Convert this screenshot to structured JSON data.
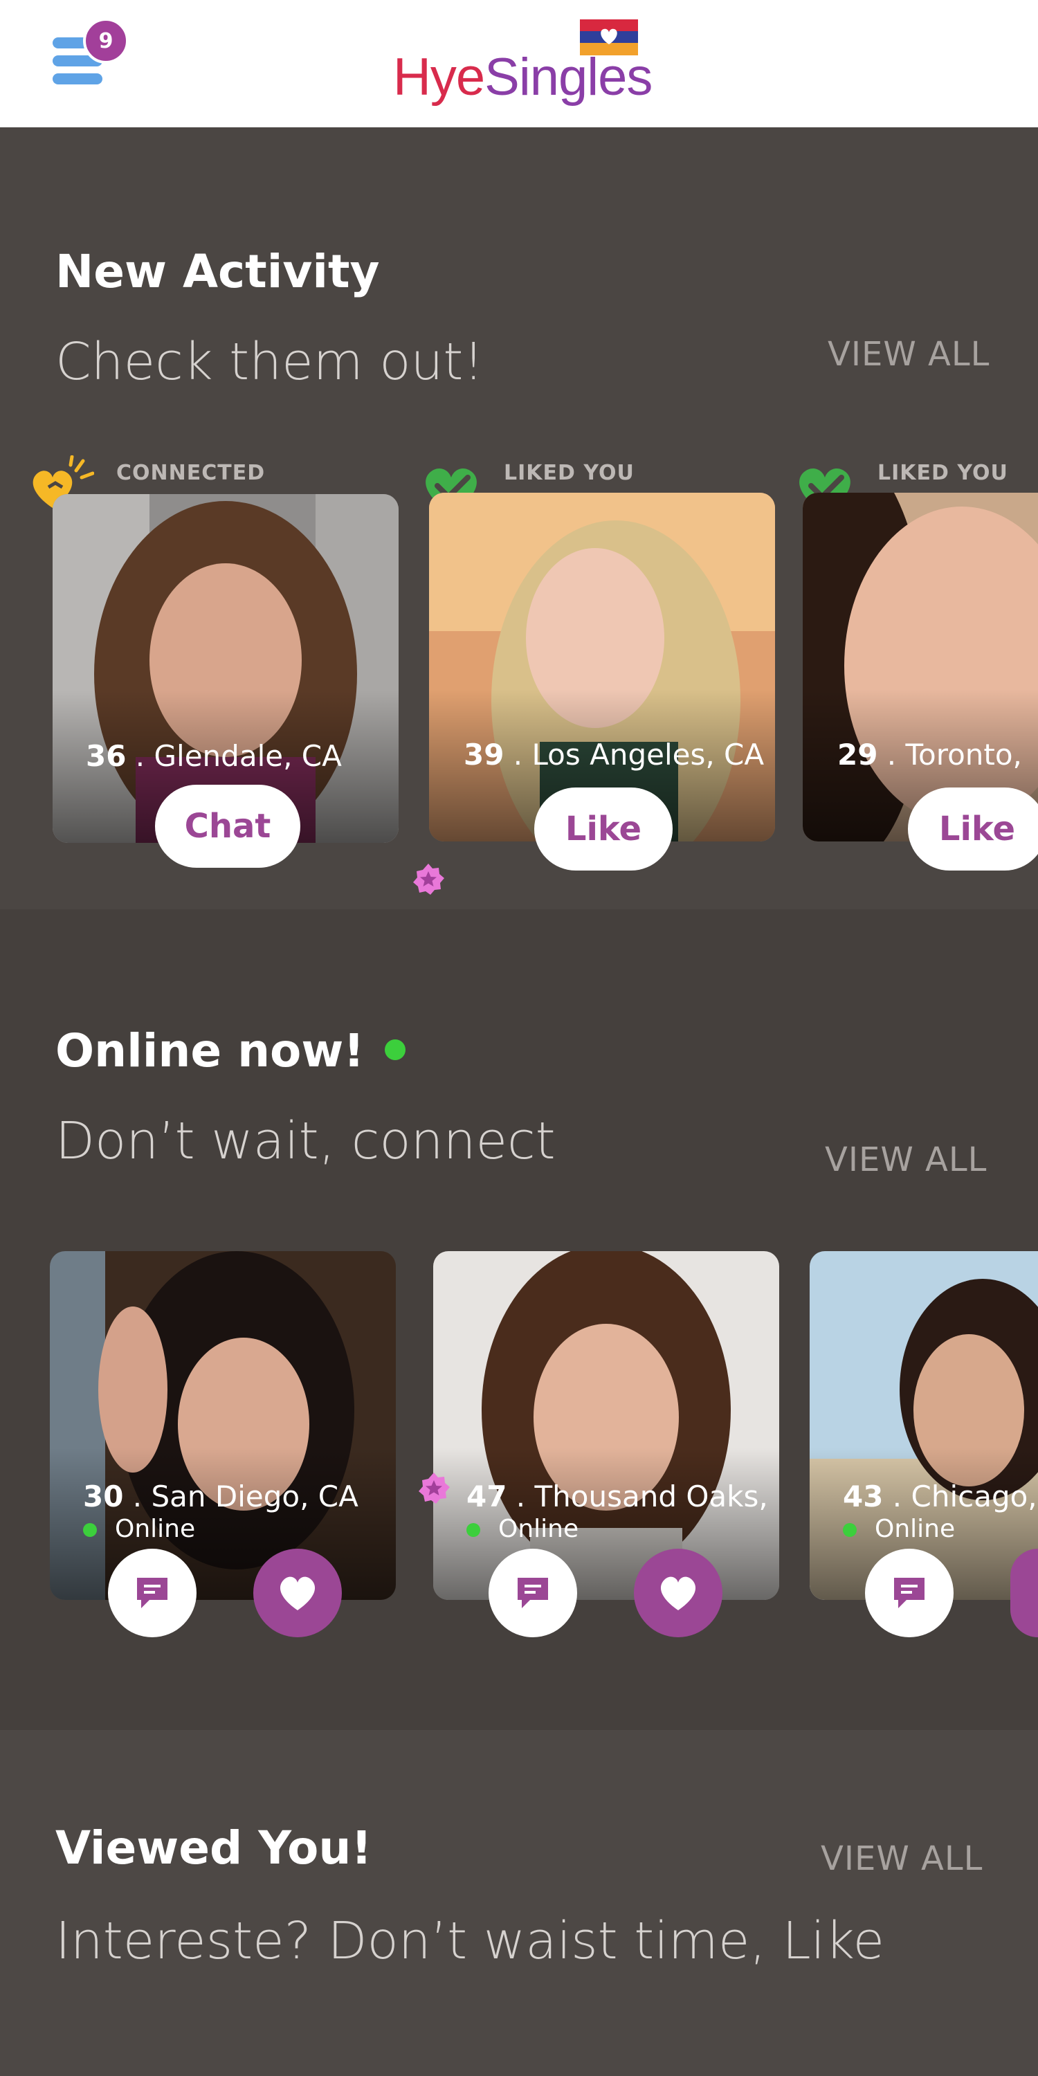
{
  "header": {
    "notification_count": "9",
    "logo": {
      "part1": "Hye",
      "part2": "Singles"
    },
    "colors": {
      "menu": "#5fa3e6",
      "badge": "#a23f9a",
      "logo_red": "#d82b4c",
      "logo_purple": "#8a3ea7"
    }
  },
  "new_activity": {
    "title": "New Activity",
    "subtitle": "Check them out!",
    "view_all": "VIEW ALL",
    "cards": [
      {
        "status": "CONNECTED",
        "status_icon": "connected-heart-icon",
        "age": "36",
        "location": " . Glendale, CA",
        "action": "Chat"
      },
      {
        "status": "LIKED YOU",
        "status_icon": "liked-heart-icon",
        "age": "39",
        "location": " . Los Angeles, CA",
        "action": "Like"
      },
      {
        "status": "LIKED YOU",
        "status_icon": "liked-heart-icon",
        "age": "29",
        "location": " . Toronto,",
        "action": "Like"
      }
    ]
  },
  "online_now": {
    "title": "Online now!",
    "subtitle": "Don’t wait, connect",
    "view_all": "VIEW ALL",
    "cards": [
      {
        "age": "30",
        "location": " . San Diego, CA",
        "status": "Online"
      },
      {
        "age": "47",
        "location": " . Thousand Oaks,",
        "status": "Online"
      },
      {
        "age": "43",
        "location": " . Chicago, I",
        "status": "Online"
      }
    ]
  },
  "viewed_you": {
    "title": "Viewed You!",
    "subtitle": "Intereste? Don’t waist time, Like",
    "view_all": "VIEW ALL"
  },
  "theme": {
    "accent": "#9b4795",
    "online": "#3ccf3c",
    "liked_green": "#3fae49",
    "connected_yellow": "#f6b826"
  }
}
